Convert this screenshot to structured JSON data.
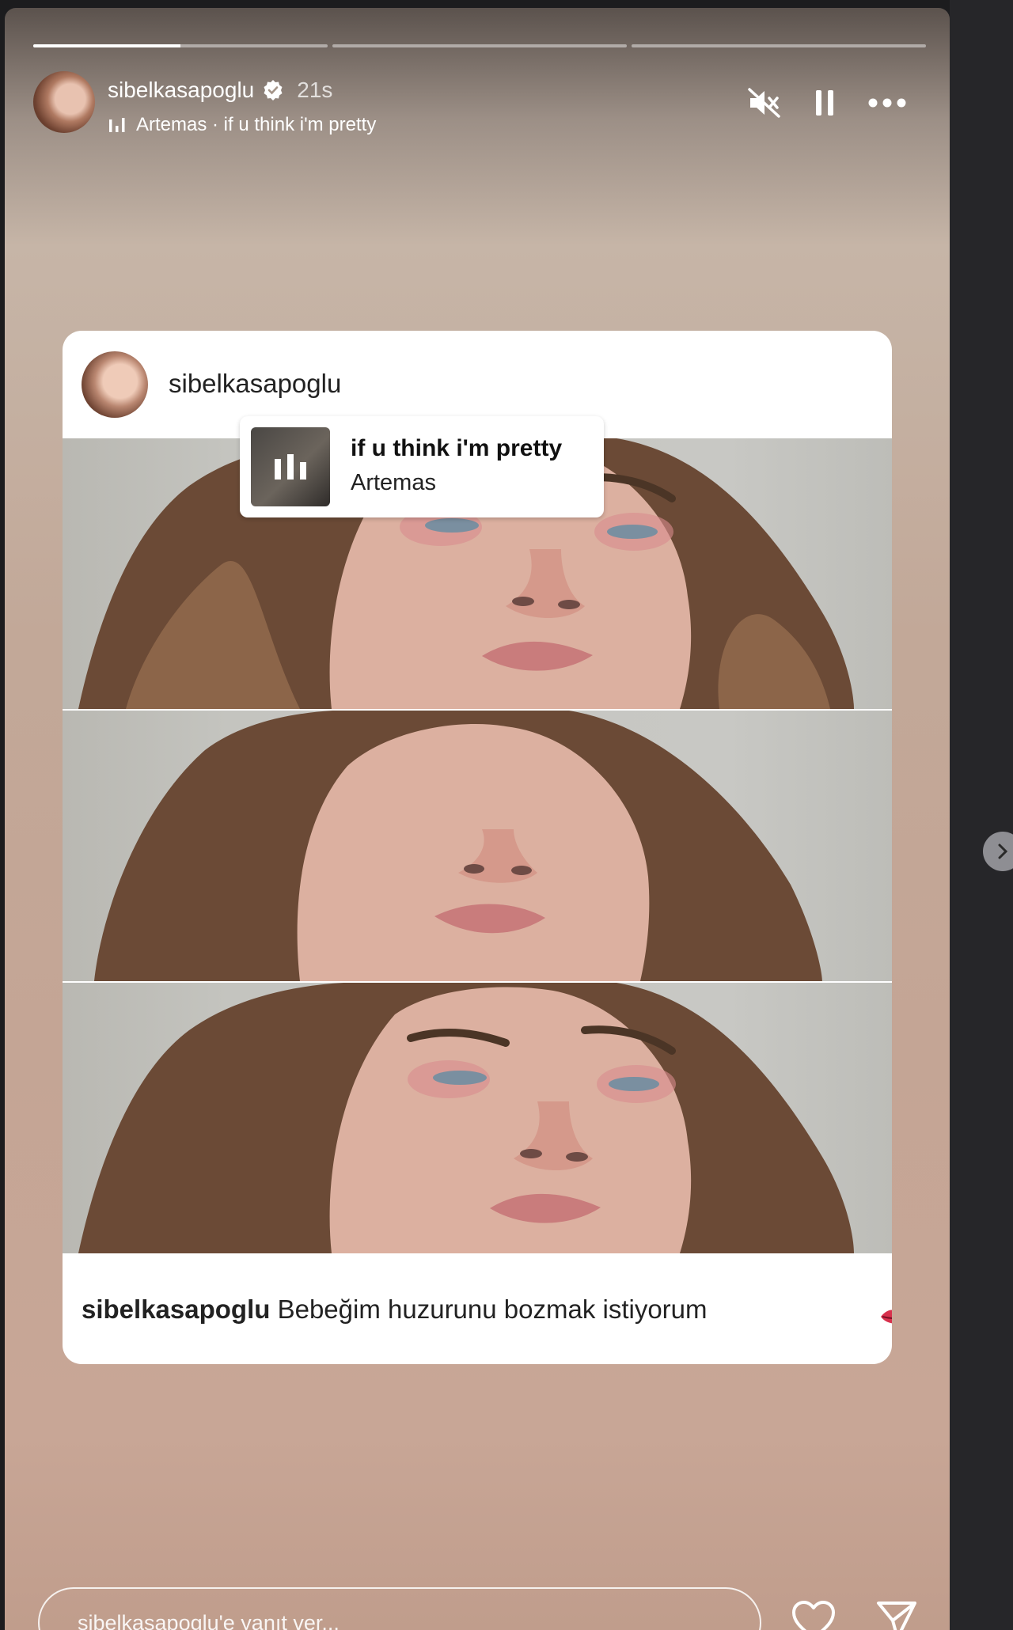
{
  "story": {
    "username": "sibelkasapoglu",
    "time": "21s",
    "verified": true,
    "music_line": "Artemas · if u think i'm pretty",
    "progress_segments": [
      0.5,
      0,
      0
    ],
    "controls": [
      "mute-icon",
      "pause-icon",
      "more-icon"
    ]
  },
  "post": {
    "username": "sibelkasapoglu",
    "song": {
      "title": "if u think i'm pretty",
      "artist": "Artemas"
    },
    "caption_user": "sibelkasapoglu",
    "caption_text": "Bebeğim huzurunu bozmak istiyorum"
  },
  "reply": {
    "placeholder": "sibelkasapoglu'e yanıt ver..."
  },
  "icons": [
    "heart-icon",
    "send-icon",
    "chevron-right-icon"
  ]
}
